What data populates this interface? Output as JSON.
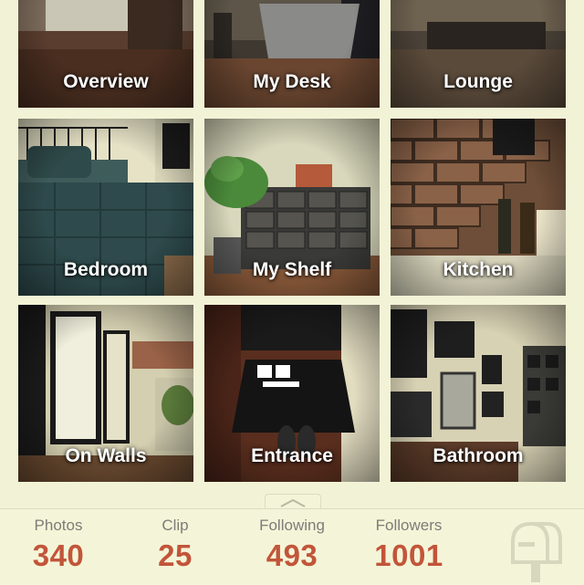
{
  "tiles": [
    {
      "label": "Overview"
    },
    {
      "label": "My Desk"
    },
    {
      "label": "Lounge"
    },
    {
      "label": "Bedroom"
    },
    {
      "label": "My Shelf"
    },
    {
      "label": "Kitchen"
    },
    {
      "label": "On Walls"
    },
    {
      "label": "Entrance"
    },
    {
      "label": "Bathroom"
    }
  ],
  "stats": {
    "photos": {
      "label": "Photos",
      "value": "340"
    },
    "clip": {
      "label": "Clip",
      "value": "25"
    },
    "following": {
      "label": "Following",
      "value": "493"
    },
    "followers": {
      "label": "Followers",
      "value": "1001"
    }
  },
  "icons": {
    "handle": "chevron-up-icon",
    "mailbox": "mailbox-icon"
  },
  "colors": {
    "background": "#f2f3d6",
    "stat_value": "#c2553a",
    "stat_label": "#7c7c78"
  }
}
